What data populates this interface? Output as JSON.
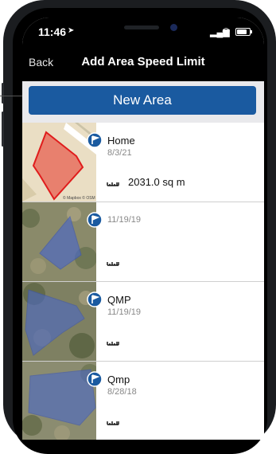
{
  "status": {
    "time": "11:46"
  },
  "nav": {
    "back_label": "Back",
    "title": "Add Area Speed Limit"
  },
  "toolbar": {
    "new_area_label": "New Area"
  },
  "areas": [
    {
      "name": "Home",
      "date": "8/3/21",
      "area": "2031.0 sq m",
      "map": "street",
      "attribution": "© Mapbox © OSM"
    },
    {
      "name": "",
      "date": "11/19/19",
      "area": "",
      "map": "satellite"
    },
    {
      "name": "QMP",
      "date": "11/19/19",
      "area": "",
      "map": "satellite"
    },
    {
      "name": "Qmp",
      "date": "8/28/18",
      "area": "",
      "map": "satellite"
    }
  ],
  "colors": {
    "accent": "#1a5aa0",
    "polygon_home": "#e8504e",
    "polygon_sat": "#4a68c8"
  }
}
